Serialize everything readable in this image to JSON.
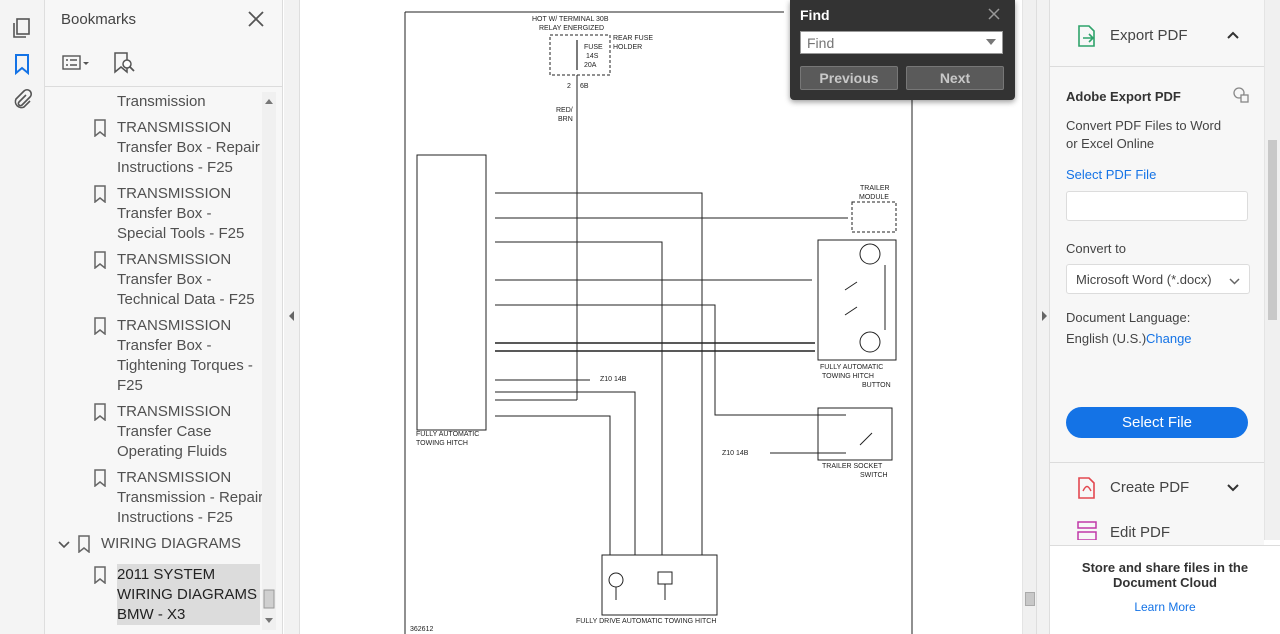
{
  "bookmarks": {
    "title": "Bookmarks",
    "items": [
      {
        "lines": [
          "Transmission"
        ],
        "partial": true
      },
      {
        "lines": [
          "TRANSMISSION",
          "Transfer Box - Repair",
          "Instructions - F25"
        ]
      },
      {
        "lines": [
          "TRANSMISSION",
          "Transfer Box -",
          "Special Tools - F25"
        ]
      },
      {
        "lines": [
          "TRANSMISSION",
          "Transfer Box -",
          "Technical Data - F25"
        ]
      },
      {
        "lines": [
          "TRANSMISSION",
          "Transfer Box -",
          "Tightening Torques -",
          "F25"
        ]
      },
      {
        "lines": [
          "TRANSMISSION",
          "Transfer Case",
          "Operating Fluids"
        ]
      },
      {
        "lines": [
          "TRANSMISSION",
          "Transmission - Repair",
          "Instructions - F25"
        ]
      }
    ],
    "group": "WIRING DIAGRAMS",
    "selected": [
      "2011 SYSTEM",
      "WIRING DIAGRAMS",
      "BMW - X3"
    ]
  },
  "find": {
    "title": "Find",
    "placeholder": "Find",
    "previous": "Previous",
    "next": "Next"
  },
  "tools": {
    "export_title": "Export PDF",
    "adobe_export": "Adobe Export PDF",
    "desc1": "Convert PDF Files to Word",
    "desc2": "or Excel Online",
    "select_pdf": "Select PDF File",
    "convert_to": "Convert to",
    "format": "Microsoft Word (*.docx)",
    "doc_lang_label": "Document Language:",
    "doc_lang": "English (U.S.)",
    "change": "Change",
    "select_file": "Select File",
    "create_pdf": "Create PDF",
    "edit_pdf": "Edit PDF",
    "store1": "Store and share files in the",
    "store2": "Document Cloud",
    "learn_more": "Learn More"
  },
  "diagram": {
    "top1": "HOT W/ TERMINAL 30B",
    "top2": "RELAY ENERGIZED",
    "fuse1": "FUSE",
    "fuse2": "14S",
    "fuse3": "20A",
    "rear1": "REAR FUSE",
    "rear2": "HOLDER",
    "fuse_pin": "2",
    "fuse_conn": "6B",
    "w_red": "RED/",
    "w_brn": "BRN",
    "trailer1": "TRAILER",
    "trailer2": "MODULE",
    "hitch1": "FULLY AUTOMATIC",
    "hitch2": "TOWING HITCH",
    "btn1": "FULLY AUTOMATIC",
    "btn2": "TOWING HITCH",
    "btn3": "BUTTON",
    "sock1": "TRAILER SOCKET",
    "sock2": "SWITCH",
    "drive": "FULLY DRIVE AUTOMATIC TOWING HITCH",
    "ground1": "Z10 14B",
    "ground2": "Z10 14B",
    "ref": "362612"
  }
}
